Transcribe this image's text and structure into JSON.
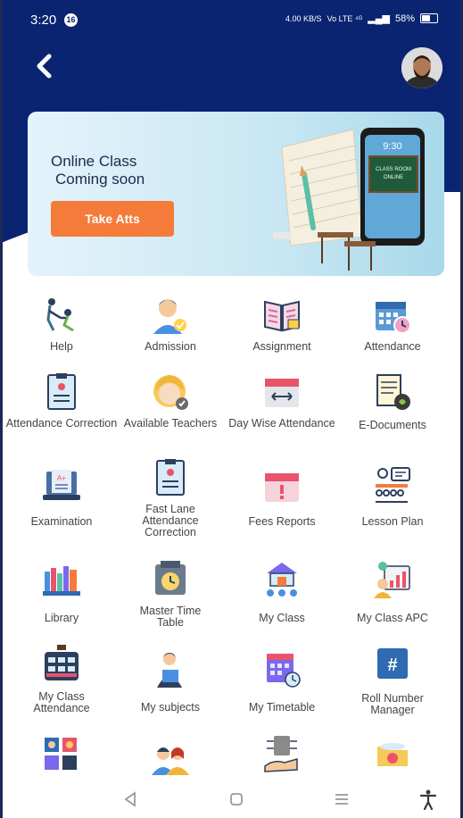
{
  "status_bar": {
    "time": "3:20",
    "notif_count": "16",
    "net_speed": "4.00 KB/S",
    "signal": "Vo LTE ⁴ᴳ",
    "battery": "58%"
  },
  "banner": {
    "title_line1": "Online Class",
    "title_line2": "Coming soon",
    "button_label": "Take Atts",
    "phone_time": "9:30",
    "board_line1": "CLASS ROOM",
    "board_line2": "ONLINE"
  },
  "menu": [
    {
      "label": "Help",
      "icon": "help-icon"
    },
    {
      "label": "Admission",
      "icon": "admission-icon"
    },
    {
      "label": "Assignment",
      "icon": "assignment-icon"
    },
    {
      "label": "Attendance",
      "icon": "attendance-icon"
    },
    {
      "label": "Attendance Correction",
      "icon": "attendance-correction-icon"
    },
    {
      "label": "Available Teachers",
      "icon": "available-teachers-icon"
    },
    {
      "label": "Day Wise Attendance",
      "icon": "day-wise-attendance-icon"
    },
    {
      "label": "E-Documents",
      "icon": "e-documents-icon"
    },
    {
      "label": "Examination",
      "icon": "examination-icon"
    },
    {
      "label": "Fast Lane Attendance Correction",
      "icon": "fast-lane-icon"
    },
    {
      "label": "Fees Reports",
      "icon": "fees-reports-icon"
    },
    {
      "label": "Lesson Plan",
      "icon": "lesson-plan-icon"
    },
    {
      "label": "Library",
      "icon": "library-icon"
    },
    {
      "label": "Master Time Table",
      "icon": "master-time-table-icon"
    },
    {
      "label": "My Class",
      "icon": "my-class-icon"
    },
    {
      "label": "My Class APC",
      "icon": "my-class-apc-icon"
    },
    {
      "label": "My Class Attendance",
      "icon": "my-class-attendance-icon"
    },
    {
      "label": "My subjects",
      "icon": "my-subjects-icon"
    },
    {
      "label": "My Timetable",
      "icon": "my-timetable-icon"
    },
    {
      "label": "Roll Number Manager",
      "icon": "roll-number-icon"
    }
  ],
  "colors": {
    "header": "#0a2472",
    "accent": "#f47b3a"
  }
}
